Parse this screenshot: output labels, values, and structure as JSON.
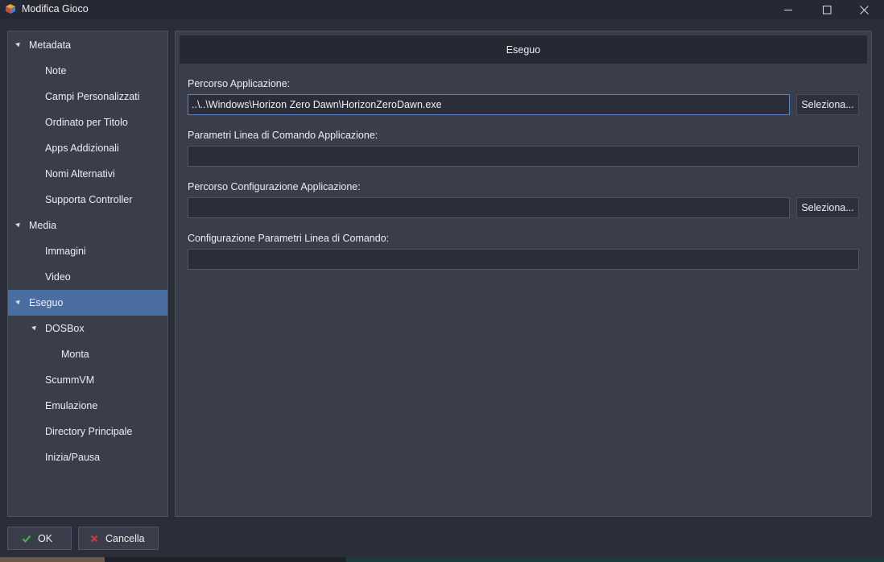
{
  "window": {
    "title": "Modifica Gioco",
    "icons": [
      "app-cube-icon",
      "minimize-icon",
      "maximize-icon",
      "close-icon"
    ]
  },
  "sidebar": {
    "items": [
      {
        "label": "Metadata",
        "level": 0,
        "expandable": true,
        "selected": false
      },
      {
        "label": "Note",
        "level": 1,
        "expandable": false,
        "selected": false
      },
      {
        "label": "Campi Personalizzati",
        "level": 1,
        "expandable": false,
        "selected": false
      },
      {
        "label": "Ordinato per Titolo",
        "level": 1,
        "expandable": false,
        "selected": false
      },
      {
        "label": "Apps Addizionali",
        "level": 1,
        "expandable": false,
        "selected": false
      },
      {
        "label": "Nomi Alternativi",
        "level": 1,
        "expandable": false,
        "selected": false
      },
      {
        "label": "Supporta Controller",
        "level": 1,
        "expandable": false,
        "selected": false
      },
      {
        "label": "Media",
        "level": 0,
        "expandable": true,
        "selected": false
      },
      {
        "label": "Immagini",
        "level": 1,
        "expandable": false,
        "selected": false
      },
      {
        "label": "Video",
        "level": 1,
        "expandable": false,
        "selected": false
      },
      {
        "label": "Eseguo",
        "level": 0,
        "expandable": true,
        "selected": true
      },
      {
        "label": "DOSBox",
        "level": 1,
        "expandable": true,
        "selected": false
      },
      {
        "label": "Monta",
        "level": 2,
        "expandable": false,
        "selected": false
      },
      {
        "label": "ScummVM",
        "level": 1,
        "expandable": false,
        "selected": false
      },
      {
        "label": "Emulazione",
        "level": 1,
        "expandable": false,
        "selected": false
      },
      {
        "label": "Directory Principale",
        "level": 1,
        "expandable": false,
        "selected": false
      },
      {
        "label": "Inizia/Pausa",
        "level": 1,
        "expandable": false,
        "selected": false
      }
    ]
  },
  "main": {
    "header": "Eseguo",
    "fields": {
      "app_path": {
        "label": "Percorso Applicazione:",
        "value": "..\\..\\Windows\\Horizon Zero Dawn\\HorizonZeroDawn.exe",
        "button": "Seleziona..."
      },
      "app_params": {
        "label": "Parametri Linea di Comando Applicazione:",
        "value": ""
      },
      "config_path": {
        "label": "Percorso Configurazione Applicazione:",
        "value": "",
        "button": "Seleziona..."
      },
      "config_params": {
        "label": "Configurazione Parametri Linea di Comando:",
        "value": ""
      }
    }
  },
  "buttons": {
    "ok": {
      "label": "OK",
      "icon": "checkmark-icon"
    },
    "cancel": {
      "label": "Cancella",
      "icon": "x-icon"
    }
  },
  "colors": {
    "background": "#2b2d38",
    "panel": "#3a3e4b",
    "header": "#262833",
    "selection": "#4a6ea0",
    "focus_border": "#5a83c0",
    "ok_icon": "#3cc03c",
    "cancel_icon": "#d23a3a"
  }
}
